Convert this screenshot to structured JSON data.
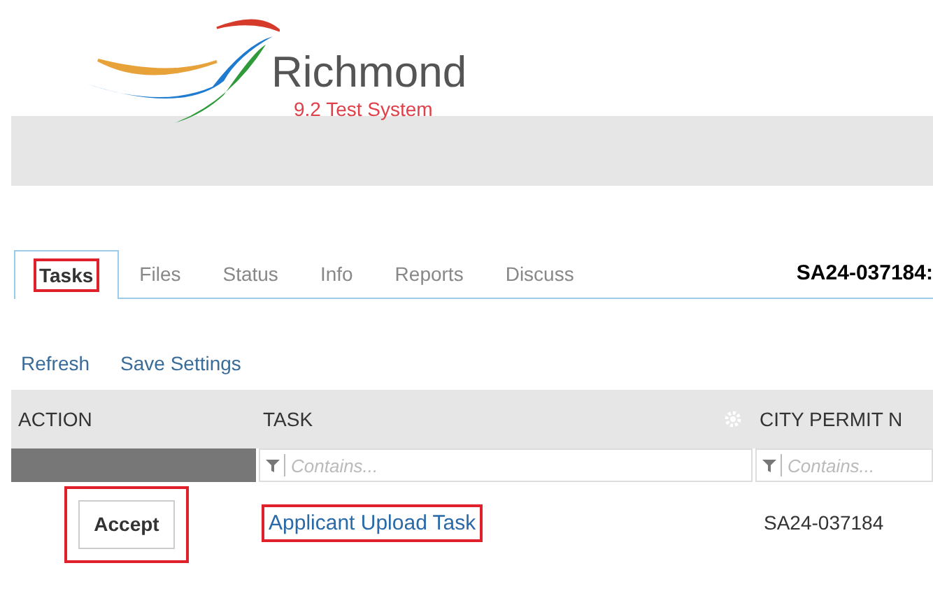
{
  "logo": {
    "name": "Richmond",
    "subtitle": "9.2 Test System"
  },
  "tabs": [
    {
      "label": "Tasks",
      "selected": true,
      "highlighted": true
    },
    {
      "label": "Files",
      "selected": false,
      "highlighted": false
    },
    {
      "label": "Status",
      "selected": false,
      "highlighted": false
    },
    {
      "label": "Info",
      "selected": false,
      "highlighted": false
    },
    {
      "label": "Reports",
      "selected": false,
      "highlighted": false
    },
    {
      "label": "Discuss",
      "selected": false,
      "highlighted": false
    }
  ],
  "record_title": "SA24-037184:",
  "toolbar": [
    "Refresh",
    "Save Settings"
  ],
  "table": {
    "columns": [
      {
        "label": "ACTION"
      },
      {
        "label": "TASK",
        "settings": true,
        "placeholder": "Contains..."
      },
      {
        "label": "CITY PERMIT N",
        "placeholder": "Contains..."
      }
    ],
    "rows": [
      {
        "action": {
          "label": "Accept",
          "highlighted": true
        },
        "task": {
          "label": "Applicant Upload Task",
          "highlighted": true
        },
        "permit": "SA24-037184"
      }
    ]
  }
}
